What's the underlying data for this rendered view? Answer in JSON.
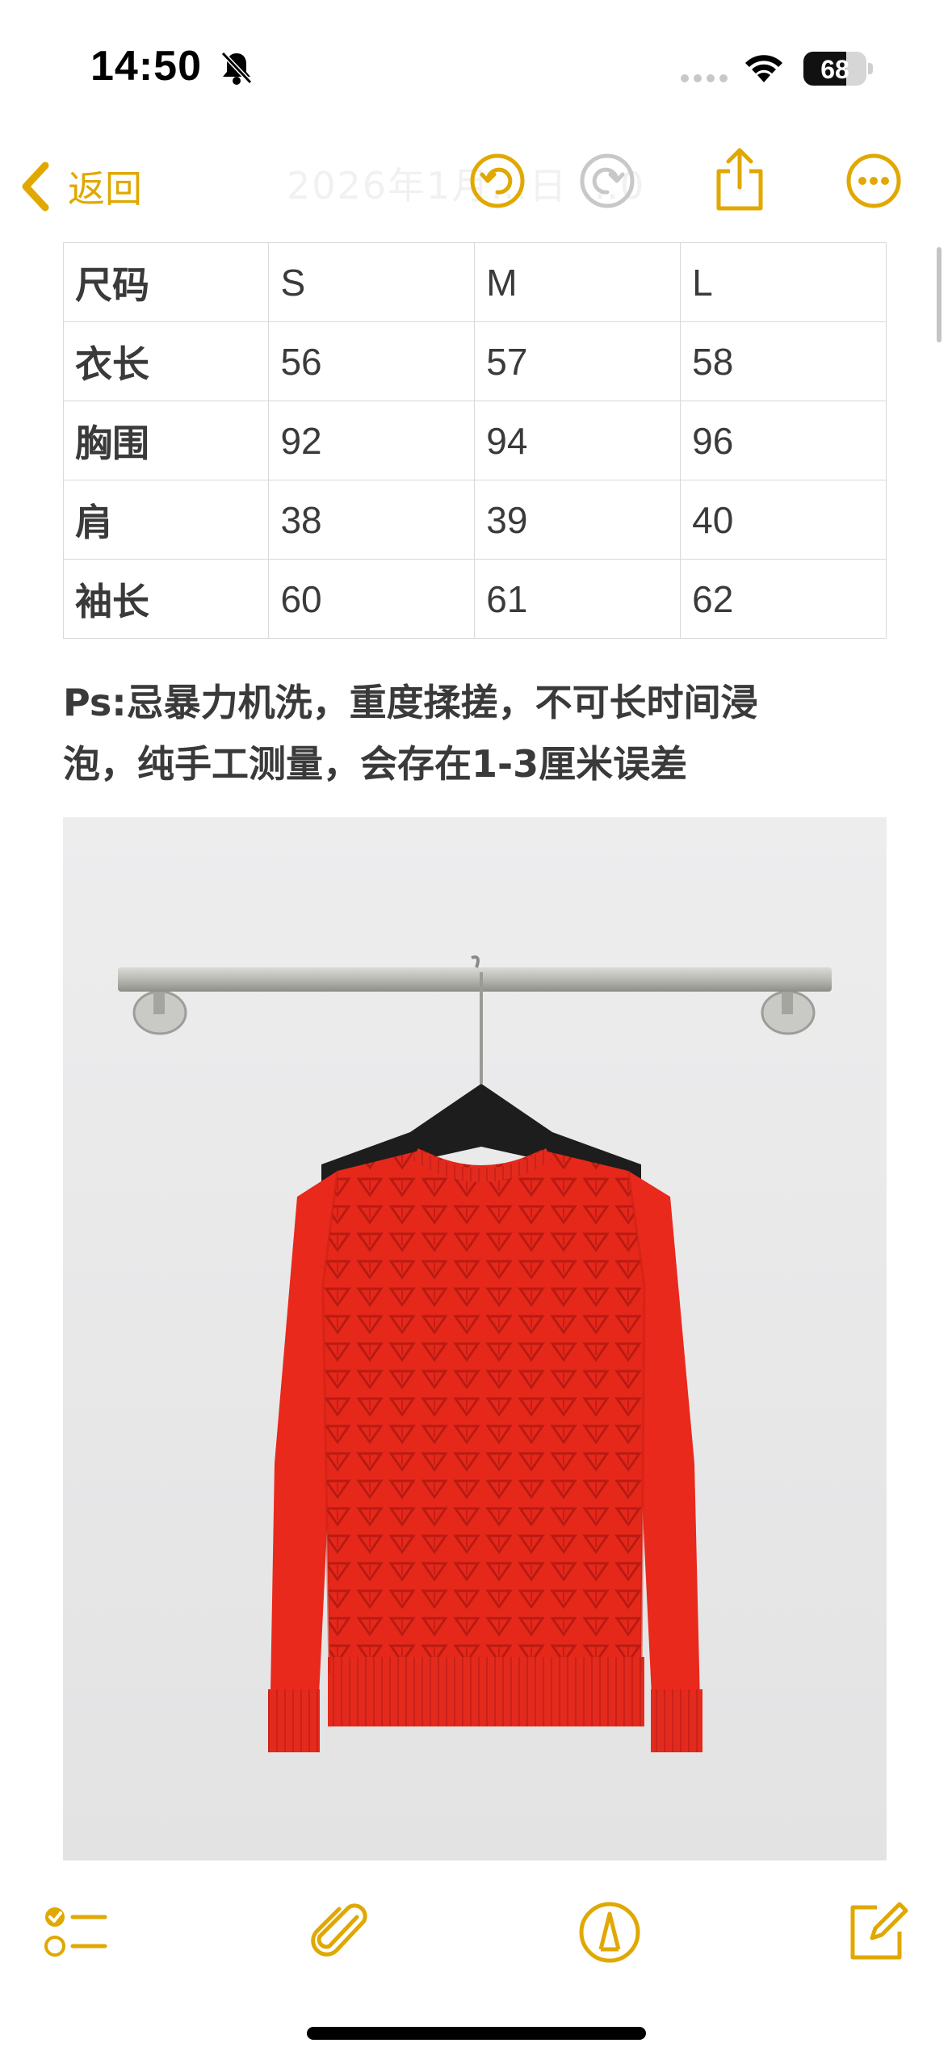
{
  "status_bar": {
    "time": "14:50",
    "battery": "68"
  },
  "nav": {
    "back_label": "返回",
    "faded_title": "2026年1月…日 …0"
  },
  "size_table": {
    "rows": [
      [
        "尺码",
        "S",
        "M",
        "L"
      ],
      [
        "衣长",
        "56",
        "57",
        "58"
      ],
      [
        "胸围",
        "92",
        "94",
        "96"
      ],
      [
        "肩",
        "38",
        "39",
        "40"
      ],
      [
        "袖长",
        "60",
        "61",
        "62"
      ]
    ]
  },
  "note": {
    "line1": "Ps:忌暴力机洗，重度揉搓，不可长时间浸",
    "line2": "泡，纯手工测量，会存在1-3厘米误差"
  },
  "colors": {
    "accent": "#e0a800",
    "sweater": "#e8291c"
  },
  "icons": [
    "bell-slash-icon",
    "signal-icon",
    "wifi-icon",
    "back-chevron-icon",
    "undo-icon",
    "redo-icon",
    "share-icon",
    "more-icon",
    "checklist-icon",
    "attachment-icon",
    "markup-icon",
    "compose-icon"
  ]
}
